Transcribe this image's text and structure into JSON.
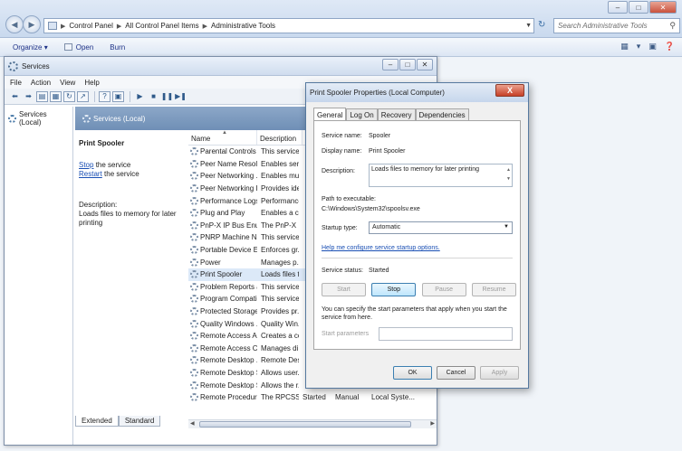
{
  "explorer": {
    "breadcrumb": [
      "Control Panel",
      "All Control Panel Items",
      "Administrative Tools"
    ],
    "search_placeholder": "Search Administrative Tools",
    "commands": [
      "Organize",
      "Open",
      "Burn"
    ]
  },
  "services_window": {
    "title": "Services",
    "menu": [
      "File",
      "Action",
      "View",
      "Help"
    ],
    "tree": {
      "root": "Services (Local)"
    },
    "pane_header": "Services (Local)",
    "selected": {
      "name": "Print Spooler",
      "stop_link": "Stop",
      "stop_suffix": " the service",
      "restart_link": "Restart",
      "restart_suffix": " the service",
      "desc_label": "Description:",
      "desc_text": "Loads files to memory for later printing"
    },
    "columns": [
      "Name",
      "Description",
      "",
      "",
      ""
    ],
    "rows": [
      {
        "name": "Parental Controls",
        "desc": "This service ...",
        "status": "",
        "startup": "",
        "logon": ""
      },
      {
        "name": "Peer Name Resolu...",
        "desc": "Enables serv...",
        "status": "",
        "startup": "",
        "logon": ""
      },
      {
        "name": "Peer Networking ...",
        "desc": "Enables mul...",
        "status": "",
        "startup": "",
        "logon": ""
      },
      {
        "name": "Peer Networking I...",
        "desc": "Provides ide...",
        "status": "",
        "startup": "",
        "logon": ""
      },
      {
        "name": "Performance Logs...",
        "desc": "Performance...",
        "status": "",
        "startup": "",
        "logon": ""
      },
      {
        "name": "Plug and Play",
        "desc": "Enables a c...",
        "status": "",
        "startup": "",
        "logon": ""
      },
      {
        "name": "PnP-X IP Bus Enu...",
        "desc": "The PnP-X ...",
        "status": "",
        "startup": "",
        "logon": ""
      },
      {
        "name": "PNRP Machine Na...",
        "desc": "This service ...",
        "status": "",
        "startup": "",
        "logon": ""
      },
      {
        "name": "Portable Device E...",
        "desc": "Enforces gr...",
        "status": "",
        "startup": "",
        "logon": ""
      },
      {
        "name": "Power",
        "desc": "Manages p...",
        "status": "",
        "startup": "",
        "logon": ""
      },
      {
        "name": "Print Spooler",
        "desc": "Loads files t...",
        "status": "",
        "startup": "",
        "logon": "",
        "selected": true
      },
      {
        "name": "Problem Reports a...",
        "desc": "This service ...",
        "status": "",
        "startup": "",
        "logon": ""
      },
      {
        "name": "Program Compati...",
        "desc": "This service ...",
        "status": "",
        "startup": "",
        "logon": ""
      },
      {
        "name": "Protected Storage",
        "desc": "Provides pr...",
        "status": "",
        "startup": "",
        "logon": ""
      },
      {
        "name": "Quality Windows ...",
        "desc": "Quality Win...",
        "status": "",
        "startup": "",
        "logon": ""
      },
      {
        "name": "Remote Access A...",
        "desc": "Creates a co...",
        "status": "",
        "startup": "",
        "logon": ""
      },
      {
        "name": "Remote Access C...",
        "desc": "Manages di...",
        "status": "",
        "startup": "",
        "logon": ""
      },
      {
        "name": "Remote Desktop ...",
        "desc": "Remote Des...",
        "status": "",
        "startup": "",
        "logon": ""
      },
      {
        "name": "Remote Desktop S...",
        "desc": "Allows user...",
        "status": "",
        "startup": "",
        "logon": ""
      },
      {
        "name": "Remote Desktop S...",
        "desc": "Allows the r...",
        "status": "",
        "startup": "",
        "logon": ""
      },
      {
        "name": "Remote Procedure...",
        "desc": "The RPCSS ...",
        "status": "Started",
        "startup": "Manual",
        "logon": "Local Syste..."
      }
    ],
    "tabs": [
      "Extended",
      "Standard"
    ]
  },
  "dialog": {
    "title": "Print Spooler Properties (Local Computer)",
    "close_label": "X",
    "tabs": [
      "General",
      "Log On",
      "Recovery",
      "Dependencies"
    ],
    "service_name_label": "Service name:",
    "service_name": "Spooler",
    "display_name_label": "Display name:",
    "display_name": "Print Spooler",
    "description_label": "Description:",
    "description": "Loads files to memory for later printing",
    "path_label": "Path to executable:",
    "path": "C:\\Windows\\System32\\spoolsv.exe",
    "startup_label": "Startup type:",
    "startup_value": "Automatic",
    "help_link": "Help me configure service startup options.",
    "status_label": "Service status:",
    "status_value": "Started",
    "buttons": {
      "start": "Start",
      "stop": "Stop",
      "pause": "Pause",
      "resume": "Resume"
    },
    "param_note": "You can specify the start parameters that apply when you start the service from here.",
    "param_label": "Start parameters",
    "param_value": "",
    "ok": "OK",
    "cancel": "Cancel",
    "apply": "Apply"
  }
}
